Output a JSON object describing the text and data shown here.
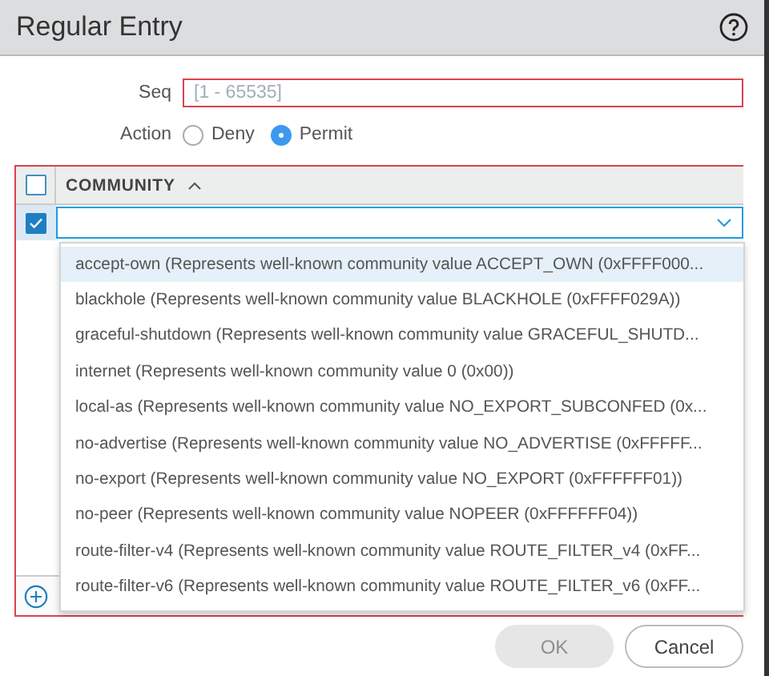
{
  "window": {
    "title": "Regular Entry"
  },
  "seq": {
    "label": "Seq",
    "placeholder": "[1 - 65535]",
    "invalid": true
  },
  "action": {
    "label": "Action",
    "options": [
      {
        "label": "Deny",
        "selected": false
      },
      {
        "label": "Permit",
        "selected": true
      }
    ]
  },
  "table": {
    "invalid": true,
    "header_checked": false,
    "columns": [
      {
        "label": "COMMUNITY",
        "sort_ascending": true
      }
    ],
    "rows": [
      {
        "checked": true,
        "value": ""
      }
    ]
  },
  "dropdown": {
    "options": [
      {
        "label": "accept-own (Represents well-known community value ACCEPT_OWN (0xFFFF000...",
        "selected": true
      },
      {
        "label": "blackhole (Represents well-known community value BLACKHOLE (0xFFFF029A))",
        "selected": false
      },
      {
        "label": "graceful-shutdown (Represents well-known community value GRACEFUL_SHUTD...",
        "selected": false
      },
      {
        "label": "internet (Represents well-known community value 0 (0x00))",
        "selected": false
      },
      {
        "label": "local-as (Represents well-known community value NO_EXPORT_SUBCONFED (0x...",
        "selected": false
      },
      {
        "label": "no-advertise (Represents well-known community value NO_ADVERTISE (0xFFFFF...",
        "selected": false
      },
      {
        "label": "no-export (Represents well-known community value NO_EXPORT (0xFFFFFF01))",
        "selected": false
      },
      {
        "label": "no-peer (Represents well-known community value NOPEER (0xFFFFFF04))",
        "selected": false
      },
      {
        "label": "route-filter-v4 (Represents well-known community value ROUTE_FILTER_v4 (0xFF...",
        "selected": false
      },
      {
        "label": "route-filter-v6 (Represents well-known community value ROUTE_FILTER_v6 (0xFF...",
        "selected": false
      }
    ]
  },
  "buttons": [
    {
      "label": "OK",
      "disabled": true
    },
    {
      "label": "Cancel",
      "disabled": false
    }
  ]
}
